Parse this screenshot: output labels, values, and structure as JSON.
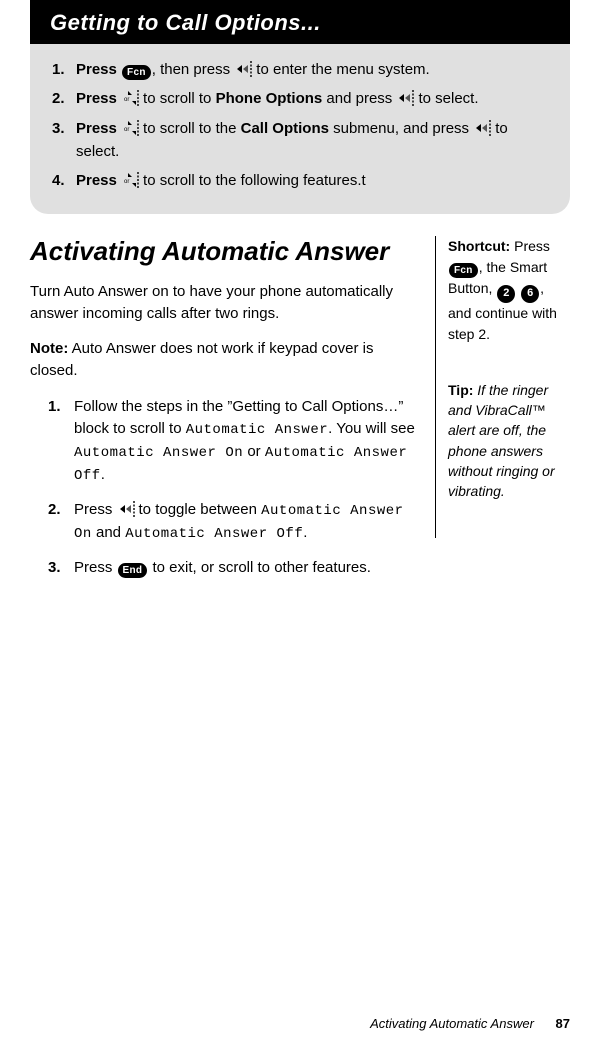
{
  "title": "Getting to Call Options...",
  "keys": {
    "fcn": "Fcn",
    "end": "End",
    "two": "2",
    "six": "6"
  },
  "gettingSteps": {
    "s1_a": "Press",
    "s1_b": ", then press",
    "s1_c": "to enter the menu system.",
    "s2_a": "Press",
    "s2_b": "to scroll to",
    "s2_phone": "Phone Options",
    "s2_c": "and press",
    "s2_d": "to select.",
    "s3_a": "Press",
    "s3_b": "to scroll to the",
    "s3_call": "Call Options",
    "s3_c": "submenu, and press",
    "s3_d": "to select.",
    "s4_a": "Press",
    "s4_b": "to scroll to the following features.t"
  },
  "section": {
    "heading": "Activating Automatic Answer",
    "intro": "Turn Auto Answer on to have your phone automatically answer incoming calls after two rings.",
    "noteLabel": "Note:",
    "noteText": "Auto Answer does not work if keypad cover is closed.",
    "steps": {
      "s1_a": "Follow the steps in the ”Getting to Call Options…” block to scroll to",
      "s1_lcd1": "Automatic Answer",
      "s1_b": ". You will see",
      "s1_lcd2": "Automatic Answer On",
      "s1_or": "or",
      "s1_lcd3": "Automatic Answer Off",
      "s1_c": ".",
      "s2_a": "Press",
      "s2_b": "to toggle between",
      "s2_lcd1": "Automatic Answer On",
      "s2_and": "and",
      "s2_lcd2": "Automatic Answer Off",
      "s2_c": ".",
      "s3_a": "Press",
      "s3_b": "to exit, or scroll to other features."
    }
  },
  "sidebar": {
    "shortcutLabel": "Shortcut:",
    "shortcut_a": "Press",
    "shortcut_b": ", the Smart Button,",
    "shortcut_c": ", and continue with step 2.",
    "tipLabel": "Tip:",
    "tipItalic": "If the ringer and VibraCall™ alert are off, the phone answers without ringing or vibrating."
  },
  "footer": {
    "section": "Activating Automatic Answer",
    "page": "87"
  }
}
